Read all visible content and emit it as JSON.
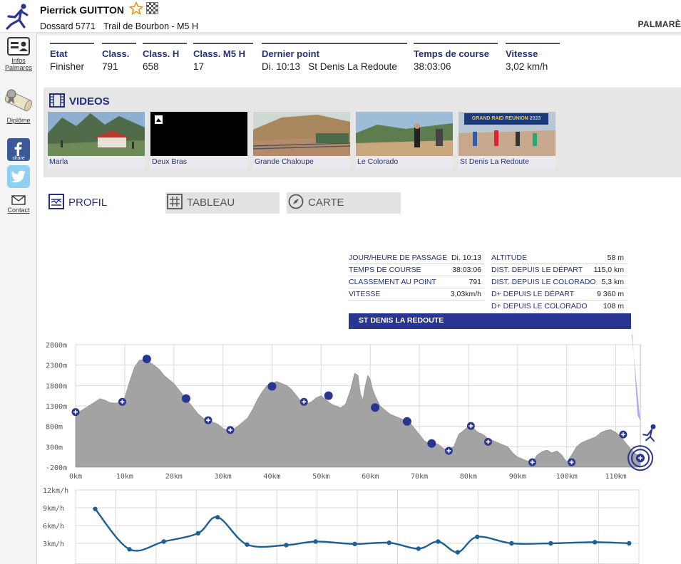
{
  "header": {
    "runner_name": "Pierrick GUITTON",
    "bib": "Dossard 5771",
    "race": "Trail de Bourbon - M5 H",
    "palmares_link": "PALMARÈ"
  },
  "sidebar": {
    "infos_label_1": "Infos",
    "infos_label_2": "Palmares",
    "diplome_label": "Diplôme",
    "share_label": "share",
    "contact_label": "Contact"
  },
  "stats": [
    {
      "label": "Etat",
      "value": "Finisher"
    },
    {
      "label": "Class.",
      "value": "791"
    },
    {
      "label": "Class. H",
      "value": "658"
    },
    {
      "label": "Class. M5 H",
      "value": "17"
    },
    {
      "label": "Dernier point",
      "value": "Di. 10:13   St Denis La Redoute"
    },
    {
      "label": "Temps de course",
      "value": "38:03:06"
    },
    {
      "label": "Vitesse",
      "value": "3,02 km/h"
    }
  ],
  "videos": {
    "title": "VIDEOS",
    "items": [
      {
        "label": "Marla",
        "overlay": ""
      },
      {
        "label": "Deux Bras",
        "overlay": ""
      },
      {
        "label": "Grande Chaloupe",
        "overlay": ""
      },
      {
        "label": "Le Colorado",
        "overlay": ""
      },
      {
        "label": "St Denis La Redoute",
        "overlay": "GRAND RAID REUNION 2023"
      }
    ]
  },
  "tabs": {
    "profil": "PROFIL",
    "tableau": "TABLEAU",
    "carte": "CARTE"
  },
  "point_info": {
    "left": [
      {
        "k": "JOUR/HEURE DE PASSAGE",
        "v": "Di. 10:13"
      },
      {
        "k": "TEMPS DE COURSE",
        "v": "38:03:06"
      },
      {
        "k": "CLASSEMENT AU POINT",
        "v": "791"
      },
      {
        "k": "VITESSE",
        "v": "3,03km/h"
      }
    ],
    "right": [
      {
        "k": "ALTITUDE",
        "v": "58 m"
      },
      {
        "k": "DIST. DEPUIS LE DÉPART",
        "v": "115,0 km"
      },
      {
        "k": "DIST. DEPUIS LE COLORADO",
        "v": "5,3 km"
      },
      {
        "k": "D+ DEPUIS LE DÉPART",
        "v": "9 360 m"
      },
      {
        "k": "D+ DEPUIS LE COLORADO",
        "v": "108 m"
      }
    ],
    "point_name": "ST DENIS LA REDOUTE"
  },
  "colors": {
    "accent": "#26307a",
    "banner": "#283593",
    "profile_fill": "#a3a3a3",
    "speed_line": "#1f5f94",
    "grid": "#d8d8d8"
  },
  "chart_data": [
    {
      "type": "area",
      "x_unit": "km",
      "y_unit": "m",
      "xlim": [
        0,
        115
      ],
      "ylim": [
        -200,
        2800
      ],
      "x_ticks": [
        0,
        10,
        20,
        30,
        40,
        50,
        60,
        70,
        80,
        90,
        100,
        110
      ],
      "x_tick_labels": [
        "0km",
        "10km",
        "20km",
        "30km",
        "40km",
        "50km",
        "60km",
        "70km",
        "80km",
        "90km",
        "100km",
        "110km"
      ],
      "y_ticks": [
        -200,
        300,
        800,
        1300,
        1800,
        2300,
        2800
      ],
      "y_tick_labels": [
        "-200m",
        "300m",
        "800m",
        "1300m",
        "1800m",
        "2300m",
        "2800m"
      ],
      "profile": [
        [
          0,
          1100
        ],
        [
          2,
          1250
        ],
        [
          4,
          1400
        ],
        [
          5,
          1480
        ],
        [
          6,
          1440
        ],
        [
          7,
          1380
        ],
        [
          8,
          1370
        ],
        [
          9,
          1380
        ],
        [
          10,
          1500
        ],
        [
          11,
          1900
        ],
        [
          12,
          2250
        ],
        [
          13,
          2420
        ],
        [
          14,
          2440
        ],
        [
          15,
          2380
        ],
        [
          16,
          2300
        ],
        [
          17,
          2200
        ],
        [
          18,
          2050
        ],
        [
          19,
          1950
        ],
        [
          20,
          1850
        ],
        [
          21,
          1700
        ],
        [
          22,
          1550
        ],
        [
          23,
          1400
        ],
        [
          24,
          1250
        ],
        [
          25,
          1100
        ],
        [
          26,
          1000
        ],
        [
          27,
          950
        ],
        [
          28,
          900
        ],
        [
          29,
          850
        ],
        [
          30,
          750
        ],
        [
          31,
          700
        ],
        [
          32,
          720
        ],
        [
          33,
          800
        ],
        [
          34,
          900
        ],
        [
          35,
          1000
        ],
        [
          36,
          1200
        ],
        [
          37,
          1450
        ],
        [
          38,
          1650
        ],
        [
          39,
          1800
        ],
        [
          40,
          1850
        ],
        [
          41,
          1900
        ],
        [
          42,
          1850
        ],
        [
          43,
          1800
        ],
        [
          44,
          1700
        ],
        [
          45,
          1550
        ],
        [
          46,
          1400
        ],
        [
          47,
          1350
        ],
        [
          48,
          1400
        ],
        [
          49,
          1500
        ],
        [
          50,
          1550
        ],
        [
          51,
          1450
        ],
        [
          52,
          1350
        ],
        [
          53,
          1300
        ],
        [
          54,
          1250
        ],
        [
          55,
          1350
        ],
        [
          56,
          1700
        ],
        [
          56.8,
          2100
        ],
        [
          57.5,
          2050
        ],
        [
          58,
          1600
        ],
        [
          58.5,
          1450
        ],
        [
          59,
          1800
        ],
        [
          59.5,
          2050
        ],
        [
          60,
          1950
        ],
        [
          60.5,
          1700
        ],
        [
          61,
          1550
        ],
        [
          62,
          1300
        ],
        [
          63,
          1200
        ],
        [
          64,
          1100
        ],
        [
          65,
          1050
        ],
        [
          66,
          1000
        ],
        [
          67,
          950
        ],
        [
          68,
          900
        ],
        [
          69,
          750
        ],
        [
          70,
          600
        ],
        [
          71,
          450
        ],
        [
          72,
          380
        ],
        [
          73,
          400
        ],
        [
          74,
          350
        ],
        [
          75,
          250
        ],
        [
          76,
          250
        ],
        [
          77,
          300
        ],
        [
          78,
          600
        ],
        [
          79,
          700
        ],
        [
          80,
          800
        ],
        [
          81,
          750
        ],
        [
          82,
          650
        ],
        [
          83,
          600
        ],
        [
          84,
          500
        ],
        [
          85,
          450
        ],
        [
          86,
          400
        ],
        [
          87,
          350
        ],
        [
          88,
          300
        ],
        [
          89,
          150
        ],
        [
          90,
          50
        ],
        [
          91,
          0
        ],
        [
          92,
          -50
        ],
        [
          93,
          -80
        ],
        [
          94,
          100
        ],
        [
          95,
          180
        ],
        [
          96,
          220
        ],
        [
          97,
          150
        ],
        [
          98,
          200
        ],
        [
          99,
          100
        ],
        [
          100,
          -80
        ],
        [
          101,
          100
        ],
        [
          102,
          300
        ],
        [
          103,
          400
        ],
        [
          104,
          450
        ],
        [
          105,
          500
        ],
        [
          106,
          550
        ],
        [
          107,
          650
        ],
        [
          108,
          700
        ],
        [
          109,
          720
        ],
        [
          110,
          650
        ],
        [
          111,
          550
        ],
        [
          112,
          400
        ],
        [
          113,
          250
        ],
        [
          114,
          130
        ],
        [
          115,
          58
        ]
      ],
      "markers": [
        {
          "km": 0,
          "alt": 1150,
          "kind": "ring"
        },
        {
          "km": 9.5,
          "alt": 1400,
          "kind": "ring"
        },
        {
          "km": 14.5,
          "alt": 2450,
          "kind": "dot"
        },
        {
          "km": 22.5,
          "alt": 1480,
          "kind": "dot"
        },
        {
          "km": 27,
          "alt": 950,
          "kind": "ring"
        },
        {
          "km": 31.5,
          "alt": 710,
          "kind": "ring"
        },
        {
          "km": 40,
          "alt": 1780,
          "kind": "dot"
        },
        {
          "km": 46.5,
          "alt": 1400,
          "kind": "ring"
        },
        {
          "km": 51.5,
          "alt": 1550,
          "kind": "dot"
        },
        {
          "km": 61,
          "alt": 1260,
          "kind": "dot"
        },
        {
          "km": 67.5,
          "alt": 920,
          "kind": "dot"
        },
        {
          "km": 72.5,
          "alt": 380,
          "kind": "dot"
        },
        {
          "km": 76,
          "alt": 200,
          "kind": "ring"
        },
        {
          "km": 80.5,
          "alt": 810,
          "kind": "ring"
        },
        {
          "km": 84,
          "alt": 420,
          "kind": "ring"
        },
        {
          "km": 93,
          "alt": -80,
          "kind": "ring"
        },
        {
          "km": 101,
          "alt": -80,
          "kind": "ring"
        },
        {
          "km": 111.5,
          "alt": 600,
          "kind": "ring"
        }
      ]
    },
    {
      "type": "line",
      "x_unit": "km",
      "y_unit": "km/h",
      "xlim": [
        0,
        115
      ],
      "ylim": [
        0,
        12
      ],
      "y_ticks": [
        3,
        6,
        9,
        12
      ],
      "y_tick_labels": [
        "3km/h",
        "6km/h",
        "9km/h",
        "12km/h"
      ],
      "series": [
        {
          "points": [
            [
              4,
              8.8
            ],
            [
              11,
              2
            ],
            [
              18,
              3.3
            ],
            [
              25,
              4.7
            ],
            [
              29,
              7.4
            ],
            [
              35,
              2.8
            ],
            [
              43,
              2.7
            ],
            [
              49,
              3.3
            ],
            [
              57,
              2.9
            ],
            [
              64,
              3.1
            ],
            [
              70,
              2.1
            ],
            [
              74,
              3.3
            ],
            [
              78,
              1.5
            ],
            [
              82,
              4.1
            ],
            [
              89,
              3
            ],
            [
              97,
              3
            ],
            [
              106,
              3.2
            ],
            [
              113,
              3
            ]
          ]
        }
      ]
    }
  ]
}
